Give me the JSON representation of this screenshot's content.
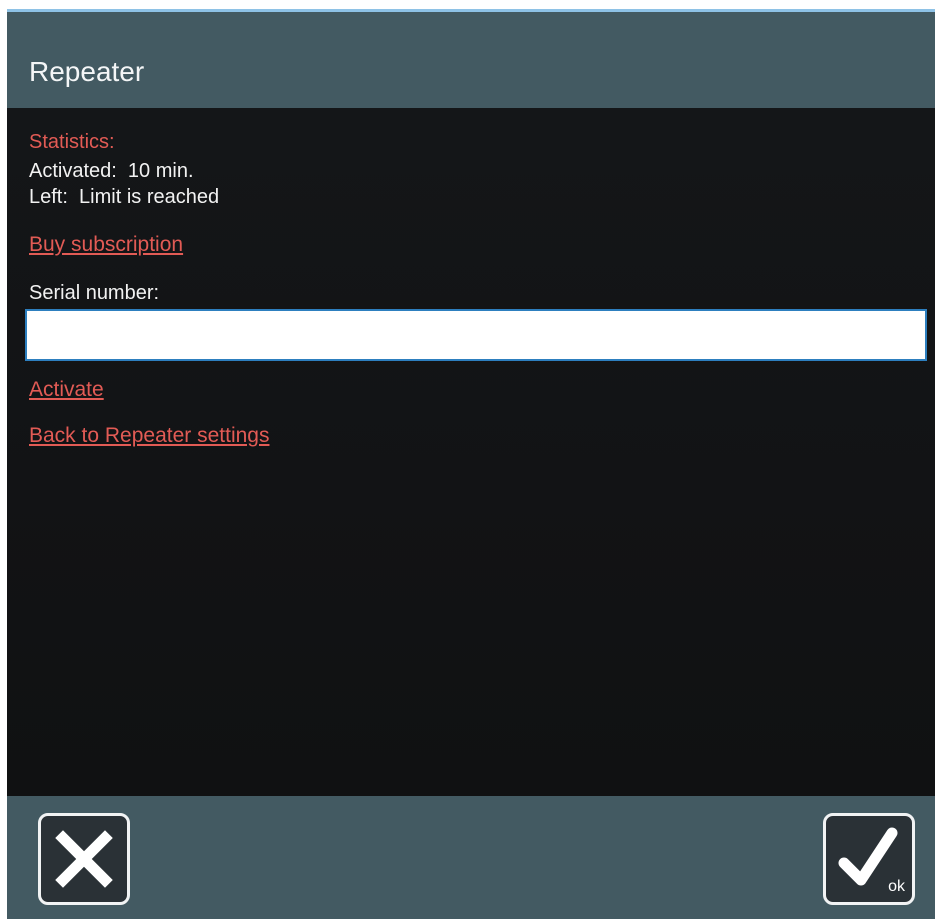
{
  "window": {
    "title": "Repeater"
  },
  "statistics": {
    "heading": "Statistics:",
    "activated_line": "Activated:  10 min.",
    "left_line": "Left:  Limit is reached"
  },
  "links": {
    "buy_subscription": "Buy subscription",
    "activate": "Activate",
    "back_to_settings": "Back to Repeater settings"
  },
  "serial": {
    "label": "Serial number:",
    "value": "",
    "placeholder": ""
  },
  "footer": {
    "cancel_icon": "close-icon",
    "ok_icon": "checkmark-icon",
    "ok_label": "ok"
  },
  "colors": {
    "header_bg": "#435a62",
    "accent_red": "#e25b55",
    "content_bg": "#121315",
    "input_border": "#2d7fbf"
  }
}
